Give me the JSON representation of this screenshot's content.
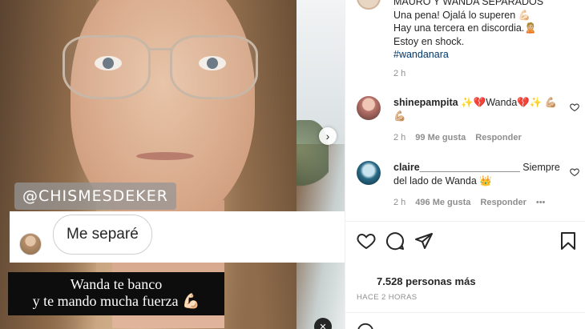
{
  "media": {
    "story_handle": "@CHISMESDEKER",
    "reply_text": "Me separé",
    "caption_lines": [
      "Wanda te banco",
      "y te mando mucha fuerza 💪🏻"
    ]
  },
  "post": {
    "title_partial": "MAURO Y WANDA SEPARADOS",
    "lines": [
      "Una pena! Ojalá lo superen 💪🏻",
      "Hay una tercera en discordia.🙎🏼",
      "Estoy en shock."
    ],
    "hashtag": "#wandanara",
    "time": "2 h"
  },
  "comments": [
    {
      "user": "shinepampita",
      "text": "✨💔Wanda💔✨ 💪🏼💪🏼",
      "time": "2 h",
      "likes": "99 Me gusta",
      "reply": "Responder"
    },
    {
      "user": "claire__________________",
      "text": "Siempre del lado de Wanda 👑",
      "time": "2 h",
      "likes": "496 Me gusta",
      "reply": "Responder",
      "more": "•••"
    }
  ],
  "likes_summary": "7.528 personas más",
  "post_age": "HACE 2 HORAS",
  "icons": {
    "like": "heart-icon",
    "comment": "comment-icon",
    "share": "send-icon",
    "save": "bookmark-icon",
    "next": "chevron-right-icon",
    "mute": "mute-icon",
    "emoji": "emoji-icon"
  }
}
